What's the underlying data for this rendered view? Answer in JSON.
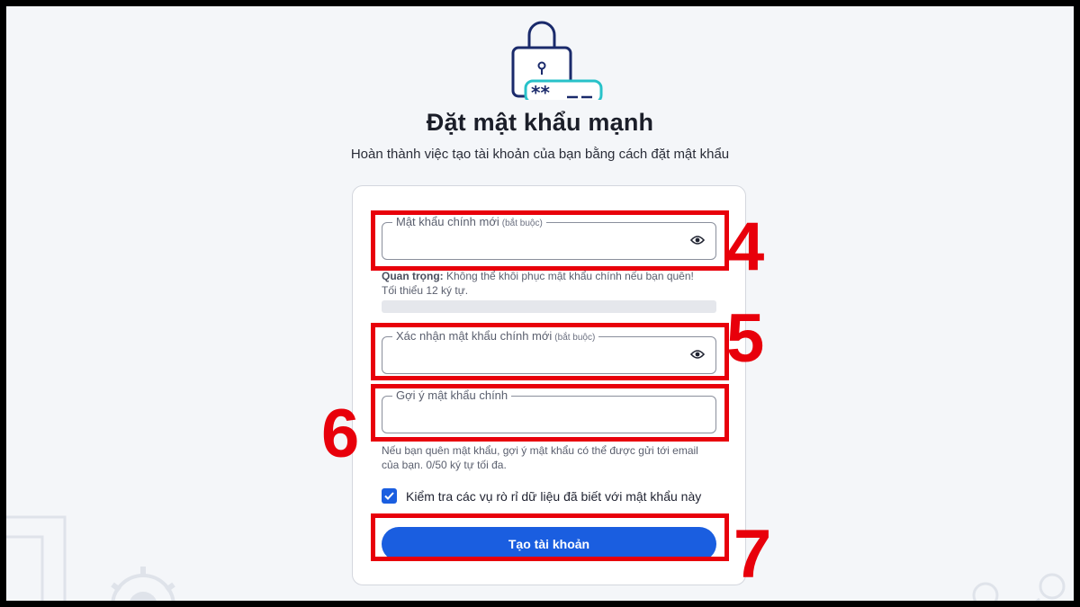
{
  "page": {
    "title": "Đặt mật khẩu mạnh",
    "subtitle": "Hoàn thành việc tạo tài khoản của bạn bằng cách đặt mật khẩu"
  },
  "form": {
    "new_password": {
      "label": "Mật khẩu chính mới",
      "required": "(bắt buộc)",
      "value": ""
    },
    "new_password_hint_bold": "Quan trọng:",
    "new_password_hint_text": " Không thể khôi phục mật khẩu chính nếu bạn quên!",
    "new_password_hint_min": "Tối thiểu 12 ký tự.",
    "strength_level": 0,
    "confirm_password": {
      "label": "Xác nhận mật khẩu chính mới",
      "required": "(bắt buộc)",
      "value": ""
    },
    "hint_field": {
      "label": "Gợi ý mật khẩu chính",
      "value": ""
    },
    "hint_field_help": "Nếu bạn quên mật khẩu, gợi ý mật khẩu có thể được gửi tới email của bạn. 0/50 ký tự tối đa.",
    "breach_check": {
      "checked": true,
      "label": "Kiểm tra các vụ rò rỉ dữ liệu đã biết với mật khẩu này"
    },
    "submit_label": "Tạo tài khoản"
  },
  "annotations": [
    "4",
    "5",
    "6",
    "7"
  ],
  "colors": {
    "accent": "#1a5ee0",
    "annotation": "#e8000b",
    "background": "#f4f6f9",
    "icon_teal": "#28c2c9",
    "icon_navy": "#1a2a6b"
  },
  "icons": [
    "padlock-password-icon",
    "eye-icon",
    "checkmark-icon",
    "gear-icon",
    "user-icon"
  ]
}
